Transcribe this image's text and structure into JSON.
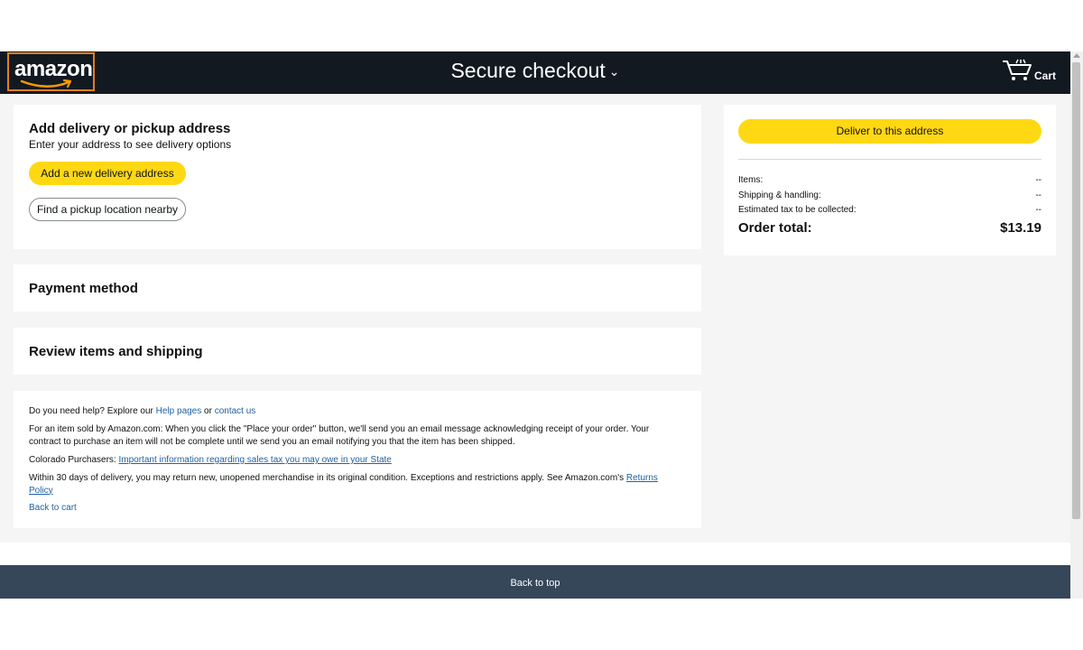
{
  "header": {
    "logo_text": "amazon",
    "title": "Secure checkout",
    "title_chevron": "⌄",
    "cart_label": "Cart"
  },
  "address_section": {
    "title": "Add delivery or pickup address",
    "subtitle": "Enter your address to see delivery options",
    "add_button": "Add a new delivery address",
    "pickup_button": "Find a pickup location nearby"
  },
  "payment_section": {
    "title": "Payment method"
  },
  "review_section": {
    "title": "Review items and shipping"
  },
  "help": {
    "line1_prefix": "Do you need help? Explore our ",
    "help_pages_link": "Help pages",
    "line1_or": " or ",
    "contact_link": "contact us",
    "line2": "For an item sold by Amazon.com: When you click the \"Place your order\" button, we'll send you an email message acknowledging receipt of your order. Your contract to purchase an item will not be complete until we send you an email notifying you that the item has been shipped.",
    "line3_prefix": "Colorado Purchasers: ",
    "line3_link": "Important information regarding sales tax you may owe in your State",
    "line4_prefix": "Within 30 days of delivery, you may return new, unopened merchandise in its original condition. Exceptions and restrictions apply. See Amazon.com's ",
    "line4_link": "Returns Policy",
    "back_to_cart": "Back to cart"
  },
  "summary": {
    "deliver_button": "Deliver to this address",
    "items_label": "Items:",
    "items_value": "--",
    "shipping_label": "Shipping & handling:",
    "shipping_value": "--",
    "tax_label": "Estimated tax to be collected:",
    "tax_value": "--",
    "total_label": "Order total:",
    "total_value": "$13.19"
  },
  "footer": {
    "back_to_top": "Back to top"
  },
  "colors": {
    "header_bg": "#131921",
    "accent_yellow": "#ffd814",
    "footer_bg": "#37475a",
    "link": "#2162a1",
    "logo_orange": "#ff9900"
  },
  "icons": [
    "amazon-smile-icon",
    "chevron-down-icon",
    "cart-icon"
  ]
}
